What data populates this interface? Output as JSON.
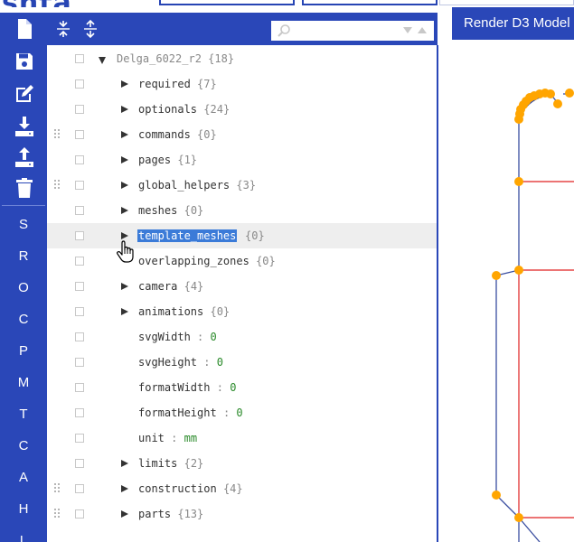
{
  "header": {
    "logo_fragment": "shta",
    "render_tab_label": "Render D3 Model"
  },
  "search": {
    "placeholder": "",
    "value": ""
  },
  "sidebar": {
    "icons": [
      "new-file-icon",
      "save-icon",
      "edit-icon",
      "download-icon",
      "upload-icon",
      "trash-icon"
    ],
    "letters": [
      "S",
      "R",
      "O",
      "C",
      "P",
      "M",
      "T",
      "C",
      "A",
      "H",
      "L"
    ]
  },
  "toolbar": {
    "icons": [
      "collapse-all-icon",
      "expand-all-icon",
      "search-icon",
      "search-prev-icon",
      "search-next-icon"
    ]
  },
  "tree": {
    "root": {
      "key": "Delga_6022_r2",
      "count": "{18}"
    },
    "rows": [
      {
        "key": "required",
        "count": "{7}"
      },
      {
        "key": "optionals",
        "count": "{24}"
      },
      {
        "key": "commands",
        "count": "{0}"
      },
      {
        "key": "pages",
        "count": "{1}"
      },
      {
        "key": "global_helpers",
        "count": "{3}"
      },
      {
        "key": "meshes",
        "count": "{0}"
      },
      {
        "key": "template_meshes",
        "count": "{0}"
      },
      {
        "key": "overlapping_zones",
        "count": "{0}"
      },
      {
        "key": "camera",
        "count": "{4}"
      },
      {
        "key": "animations",
        "count": "{0}"
      },
      {
        "key": "svgWidth",
        "value": "0"
      },
      {
        "key": "svgHeight",
        "value": "0"
      },
      {
        "key": "formatWidth",
        "value": "0"
      },
      {
        "key": "formatHeight",
        "value": "0"
      },
      {
        "key": "unit",
        "value": "mm"
      },
      {
        "key": "limits",
        "count": "{2}"
      },
      {
        "key": "construction",
        "count": "{4}"
      },
      {
        "key": "parts",
        "count": "{13}"
      }
    ],
    "separator": ":"
  },
  "colors": {
    "brand_blue": "#2a47b8",
    "selection": "#3b7bd8",
    "node_orange": "#ffa500",
    "edge_blue": "#3a4ea0",
    "edge_red": "#e02020"
  }
}
